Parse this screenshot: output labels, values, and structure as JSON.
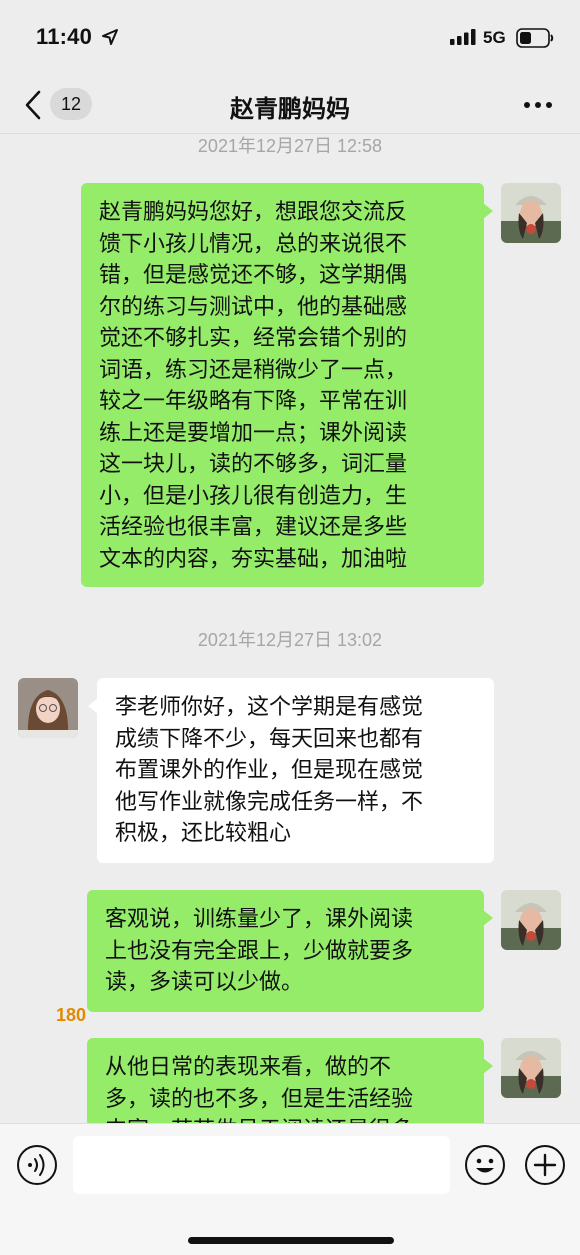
{
  "status_bar": {
    "time": "11:40",
    "network": "5G",
    "icons": [
      "location-arrow-icon",
      "signal-icon",
      "battery-icon"
    ]
  },
  "nav": {
    "back_badge": "12",
    "title": "赵青鹏妈妈",
    "icons": [
      "back-chevron-icon",
      "more-icon"
    ]
  },
  "chat": {
    "timestamps": [
      "2021年12月27日 12:58",
      "2021年12月27日 13:02"
    ],
    "messages": [
      {
        "sender": "me",
        "lines": [
          "赵青鹏妈妈您好，想跟您交流反",
          "馈下小孩儿情况，总的来说很不",
          "错，但是感觉还不够，这学期偶",
          "尔的练习与测试中，他的基础感",
          "觉还不够扎实，经常会错个别的",
          "词语，练习还是稍微少了一点，",
          "较之一年级略有下降，平常在训",
          "练上还是要增加一点；课外阅读",
          "这一块儿，读的不够多，词汇量",
          "小，但是小孩儿很有创造力，生",
          "活经验也很丰富，建议还是多些",
          "文本的内容，夯实基础，加油啦"
        ]
      },
      {
        "sender": "contact",
        "lines": [
          "李老师你好，这个学期是有感觉",
          "成绩下降不少，每天回来也都有",
          "布置课外的作业，但是现在感觉",
          "他写作业就像完成任务一样，不",
          "积极，还比较粗心"
        ]
      },
      {
        "sender": "me",
        "lines": [
          "客观说，训练量少了，课外阅读",
          "上也没有完全跟上，少做就要多",
          "读，多读可以少做。"
        ]
      },
      {
        "sender": "me",
        "lines": [
          "从他日常的表现来看，做的不",
          "多，读的也不多，但是生活经验",
          "丰富，若若做号于阅读还是很多"
        ]
      }
    ],
    "overlay_number": "180"
  },
  "input_bar": {
    "placeholder": "",
    "icons": [
      "voice-icon",
      "emoji-icon",
      "plus-icon"
    ]
  },
  "colors": {
    "background": "#ededed",
    "bubble_out": "#95ec69",
    "bubble_in": "#ffffff",
    "timestamp": "#a6a6a6"
  }
}
